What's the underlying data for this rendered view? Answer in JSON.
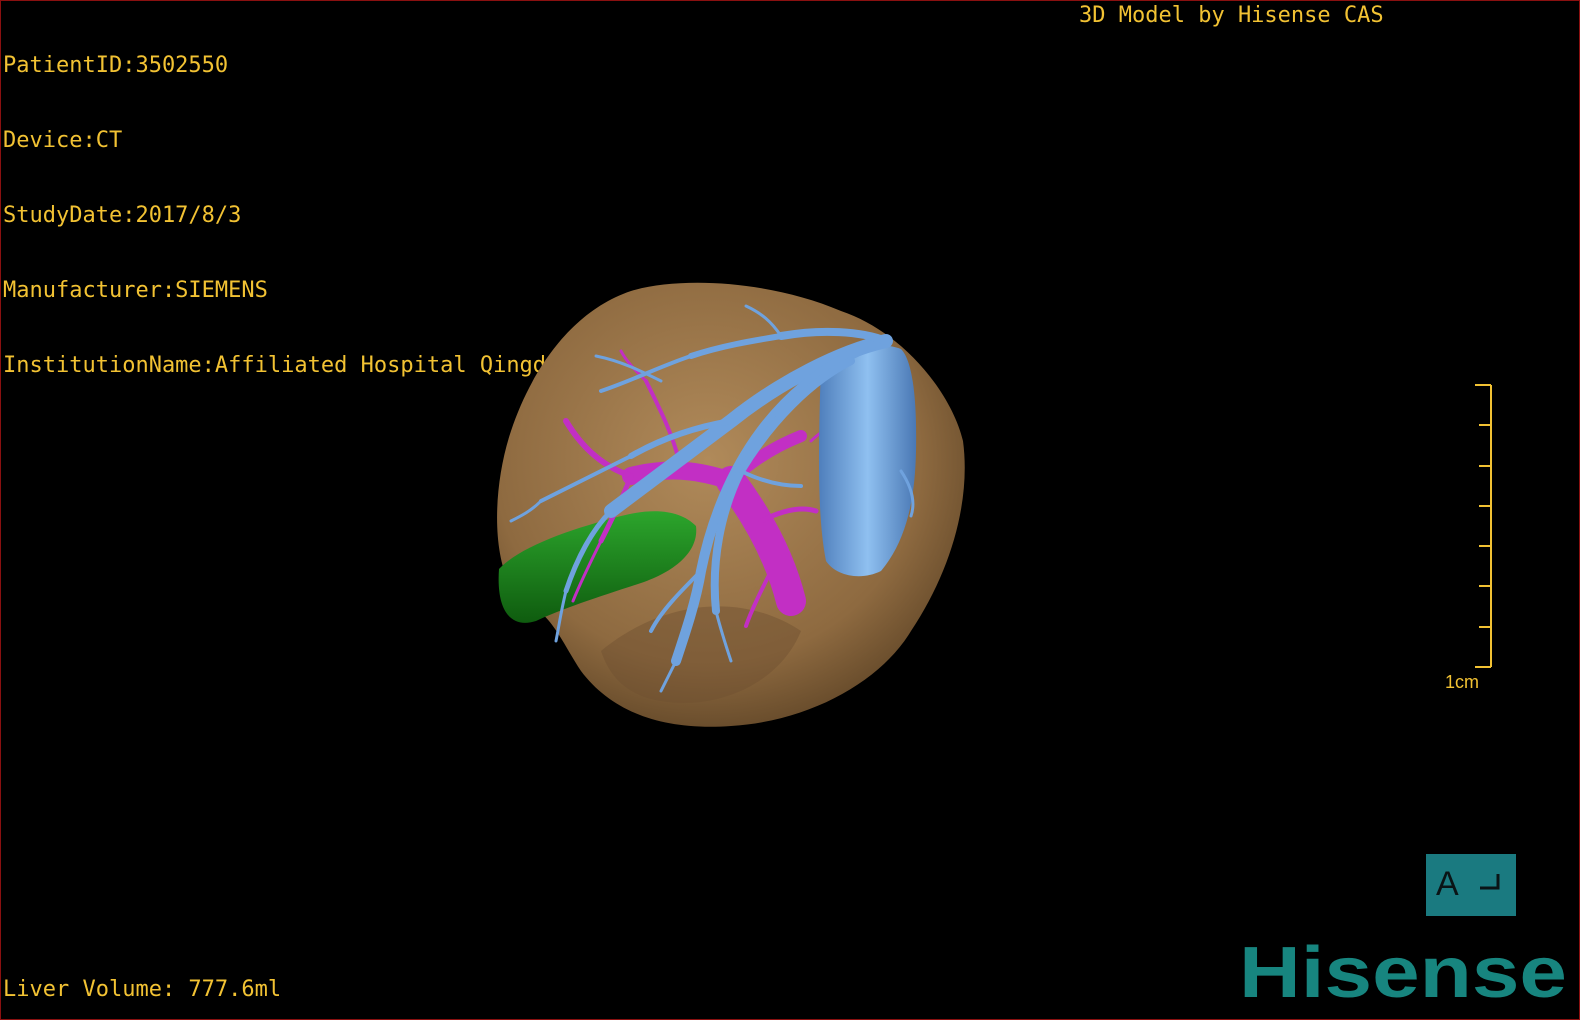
{
  "info": {
    "patient_id": "PatientID:3502550",
    "device": "Device:CT",
    "study_date": "StudyDate:2017/8/3",
    "manufacturer": "Manufacturer:SIEMENS",
    "institution": "InstitutionName:Affiliated Hospital Qingdao University-C"
  },
  "header": {
    "model_credit": "3D Model by Hisense CAS"
  },
  "footer": {
    "liver_volume": "Liver Volume: 777.6ml"
  },
  "scale": {
    "label": "1cm"
  },
  "orientation": {
    "letter": "A",
    "icon": "orientation-marker-icon"
  },
  "brand": {
    "name": "Hisense"
  },
  "colors": {
    "overlay_text": "#f2c233",
    "liver": "#9c7548",
    "hepatic_vessels": "#6fa2de",
    "portal_vessels": "#c22fc4",
    "gallbladder": "#1f8f1f",
    "brand": "#17857f",
    "orientation_box": "#1a7a80",
    "frame_border": "#8a1010"
  }
}
